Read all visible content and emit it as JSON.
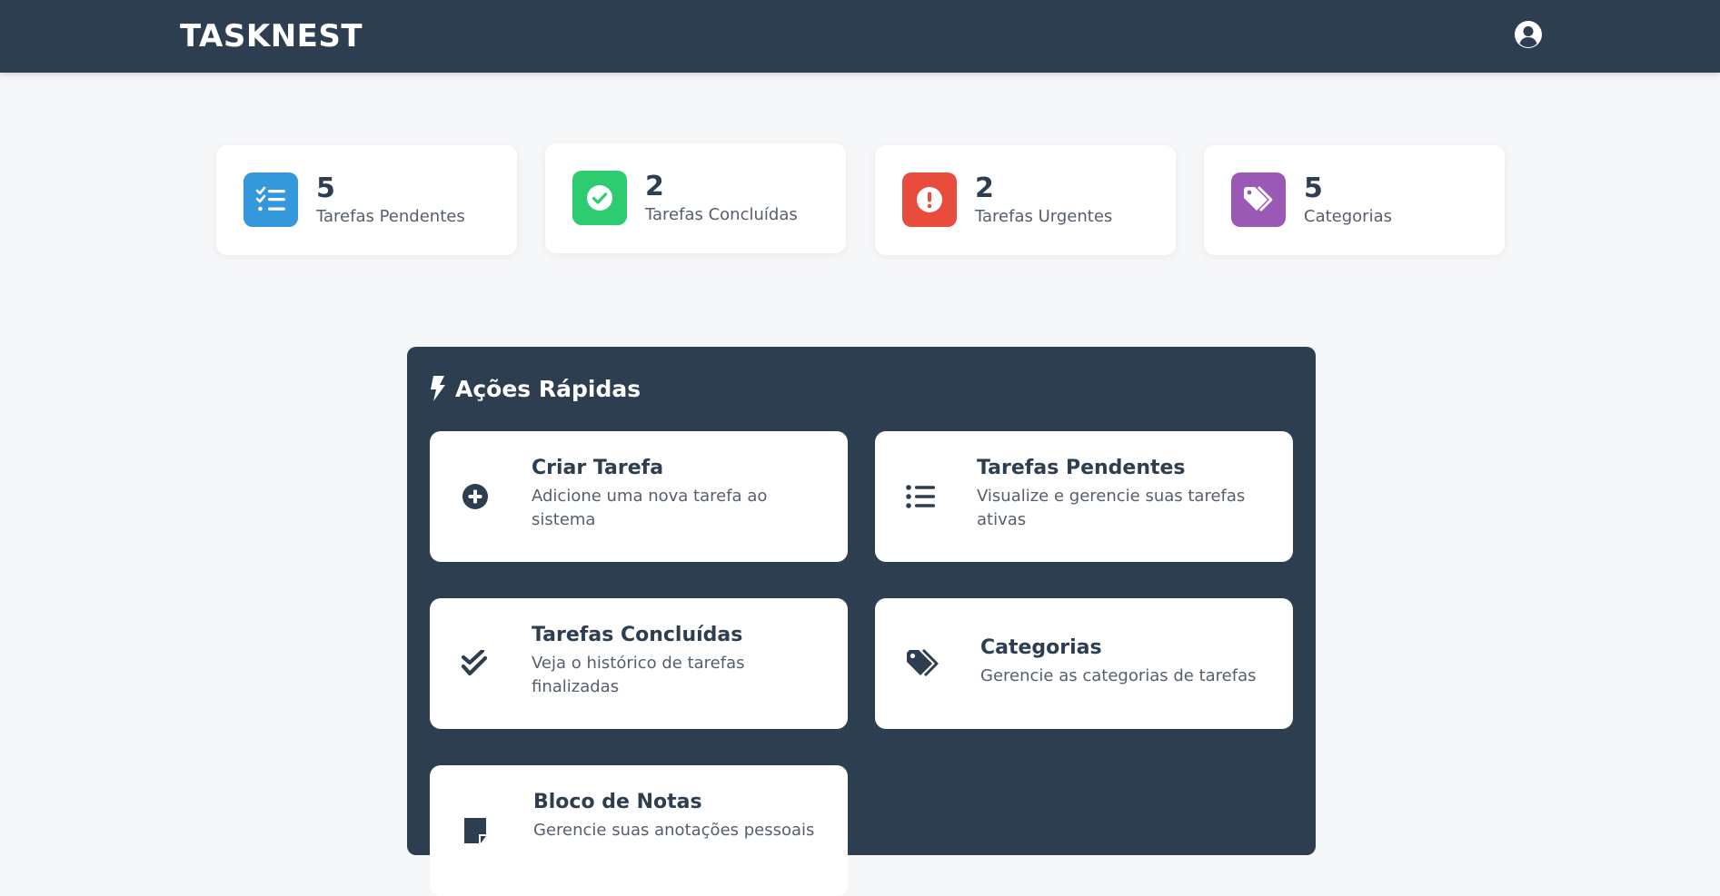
{
  "header": {
    "brand": "TASKNEST",
    "user_icon": "user-circle-icon"
  },
  "stats": [
    {
      "value": "5",
      "label": "Tarefas Pendentes",
      "icon": "task-list-icon",
      "color": "#3498db"
    },
    {
      "value": "2",
      "label": "Tarefas Concluídas",
      "icon": "check-circle-icon",
      "color": "#2ecc71"
    },
    {
      "value": "2",
      "label": "Tarefas Urgentes",
      "icon": "exclamation-circle-icon",
      "color": "#e74c3c"
    },
    {
      "value": "5",
      "label": "Categorias",
      "icon": "tags-icon",
      "color": "#9b59b6"
    }
  ],
  "quick_actions": {
    "title": "Ações Rápidas",
    "title_icon": "bolt-icon",
    "items": [
      {
        "title": "Criar Tarefa",
        "description": "Adicione uma nova tarefa ao sistema",
        "icon": "plus-circle-icon"
      },
      {
        "title": "Tarefas Pendentes",
        "description": "Visualize e gerencie suas tarefas ativas",
        "icon": "list-icon"
      },
      {
        "title": "Tarefas Concluídas",
        "description": "Veja o histórico de tarefas finalizadas",
        "icon": "double-check-icon"
      },
      {
        "title": "Categorias",
        "description": "Gerencie as categorias de tarefas",
        "icon": "tags-icon"
      },
      {
        "title": "Bloco de Notas",
        "description": "Gerencie suas anotações pessoais",
        "icon": "sticky-note-icon"
      }
    ]
  },
  "colors": {
    "navbar": "#2c3e50",
    "background": "#f6f7f9",
    "text": "#2c3e50"
  }
}
